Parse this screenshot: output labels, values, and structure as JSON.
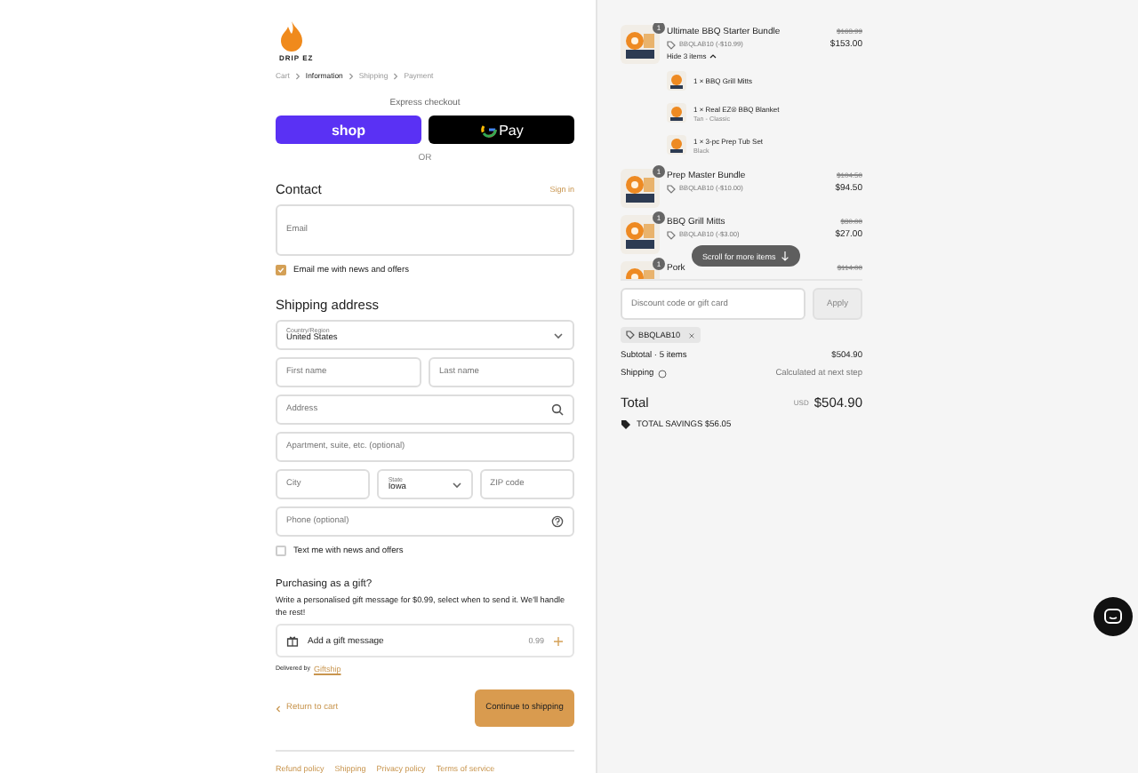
{
  "logo": {
    "text": "DRIP EZ"
  },
  "breadcrumb": [
    {
      "label": "Cart",
      "selected": false
    },
    {
      "label": "Information",
      "selected": true
    },
    {
      "label": "Shipping",
      "selected": false
    },
    {
      "label": "Payment",
      "selected": false
    }
  ],
  "express": {
    "title": "Express checkout",
    "buttons": [
      {
        "kind": "shop",
        "label": "shop"
      },
      {
        "kind": "gpay",
        "label": "Pay"
      }
    ],
    "divider": "OR"
  },
  "contact": {
    "title": "Contact",
    "link": "Sign in",
    "email": {
      "placeholder": "Email"
    },
    "newsletter": {
      "label": "Email me with news and offers",
      "checked": true
    }
  },
  "shipping": {
    "title": "Shipping address",
    "rows": [
      [
        {
          "kind": "select",
          "label": "Country/Region",
          "value": "United States"
        }
      ],
      [
        {
          "kind": "input",
          "placeholder": "First name"
        },
        {
          "kind": "input",
          "placeholder": "Last name"
        }
      ],
      [
        {
          "kind": "search",
          "placeholder": "Address"
        }
      ],
      [
        {
          "kind": "input",
          "placeholder": "Apartment, suite, etc. (optional)"
        }
      ],
      [
        {
          "kind": "input",
          "placeholder": "City"
        },
        {
          "kind": "select",
          "label": "State",
          "value": "Iowa"
        },
        {
          "kind": "input",
          "placeholder": "ZIP code"
        }
      ],
      [
        {
          "kind": "phone",
          "placeholder": "Phone (optional)"
        }
      ]
    ],
    "sms": {
      "label": "Text me with news and offers",
      "checked": false
    }
  },
  "gift": {
    "title": "Purchasing as a gift?",
    "text": "Write a personalised gift message for $0.99, select when to send it. We'll handle the rest!",
    "row": {
      "label": "Add a gift message",
      "price": "0.99"
    },
    "delivered": "Delivered by",
    "delivered_link": "Giftship"
  },
  "actions": {
    "back": "Return to cart",
    "continue": "Continue to shipping"
  },
  "footer_links": [
    "Refund policy",
    "Shipping",
    "Privacy policy",
    "Terms of service"
  ],
  "items": [
    {
      "name": "Ultimate BBQ Starter Bundle",
      "discount": "BBQLAB10 (-$10.99)",
      "old_price": "$163.99",
      "price": "$153.00",
      "quantity": "1",
      "toggle": "Hide 3 items",
      "expanded": true,
      "children": [
        {
          "name": "1 × BBQ Grill Mitts"
        },
        {
          "name": "1 × Real EZ® BBQ Blanket",
          "variant": "Tan - Classic"
        },
        {
          "name": "1 × 3-pc Prep Tub Set",
          "variant": "Black"
        }
      ]
    },
    {
      "name": "Prep Master Bundle",
      "discount": "BBQLAB10 (-$10.00)",
      "old_price": "$104.50",
      "price": "$94.50",
      "quantity": "1"
    },
    {
      "name": "BBQ Grill Mitts",
      "discount": "BBQLAB10 (-$3.00)",
      "old_price": "$30.00",
      "price": "$27.00",
      "quantity": "1"
    },
    {
      "name": "Pork",
      "old_price": "$114.00",
      "quantity": "1"
    }
  ],
  "scroll_hint": "Scroll for more items",
  "discount": {
    "placeholder": "Discount code or gift card",
    "button": "Apply",
    "tag": "BBQLAB10"
  },
  "summary": {
    "subtotal_label": "Subtotal · 5 items",
    "subtotal": "$504.90",
    "shipping_label": "Shipping",
    "shipping": "Calculated at next step",
    "total_label": "Total",
    "currency": "USD",
    "total": "$504.90",
    "savings": "TOTAL SAVINGS $56.05"
  }
}
